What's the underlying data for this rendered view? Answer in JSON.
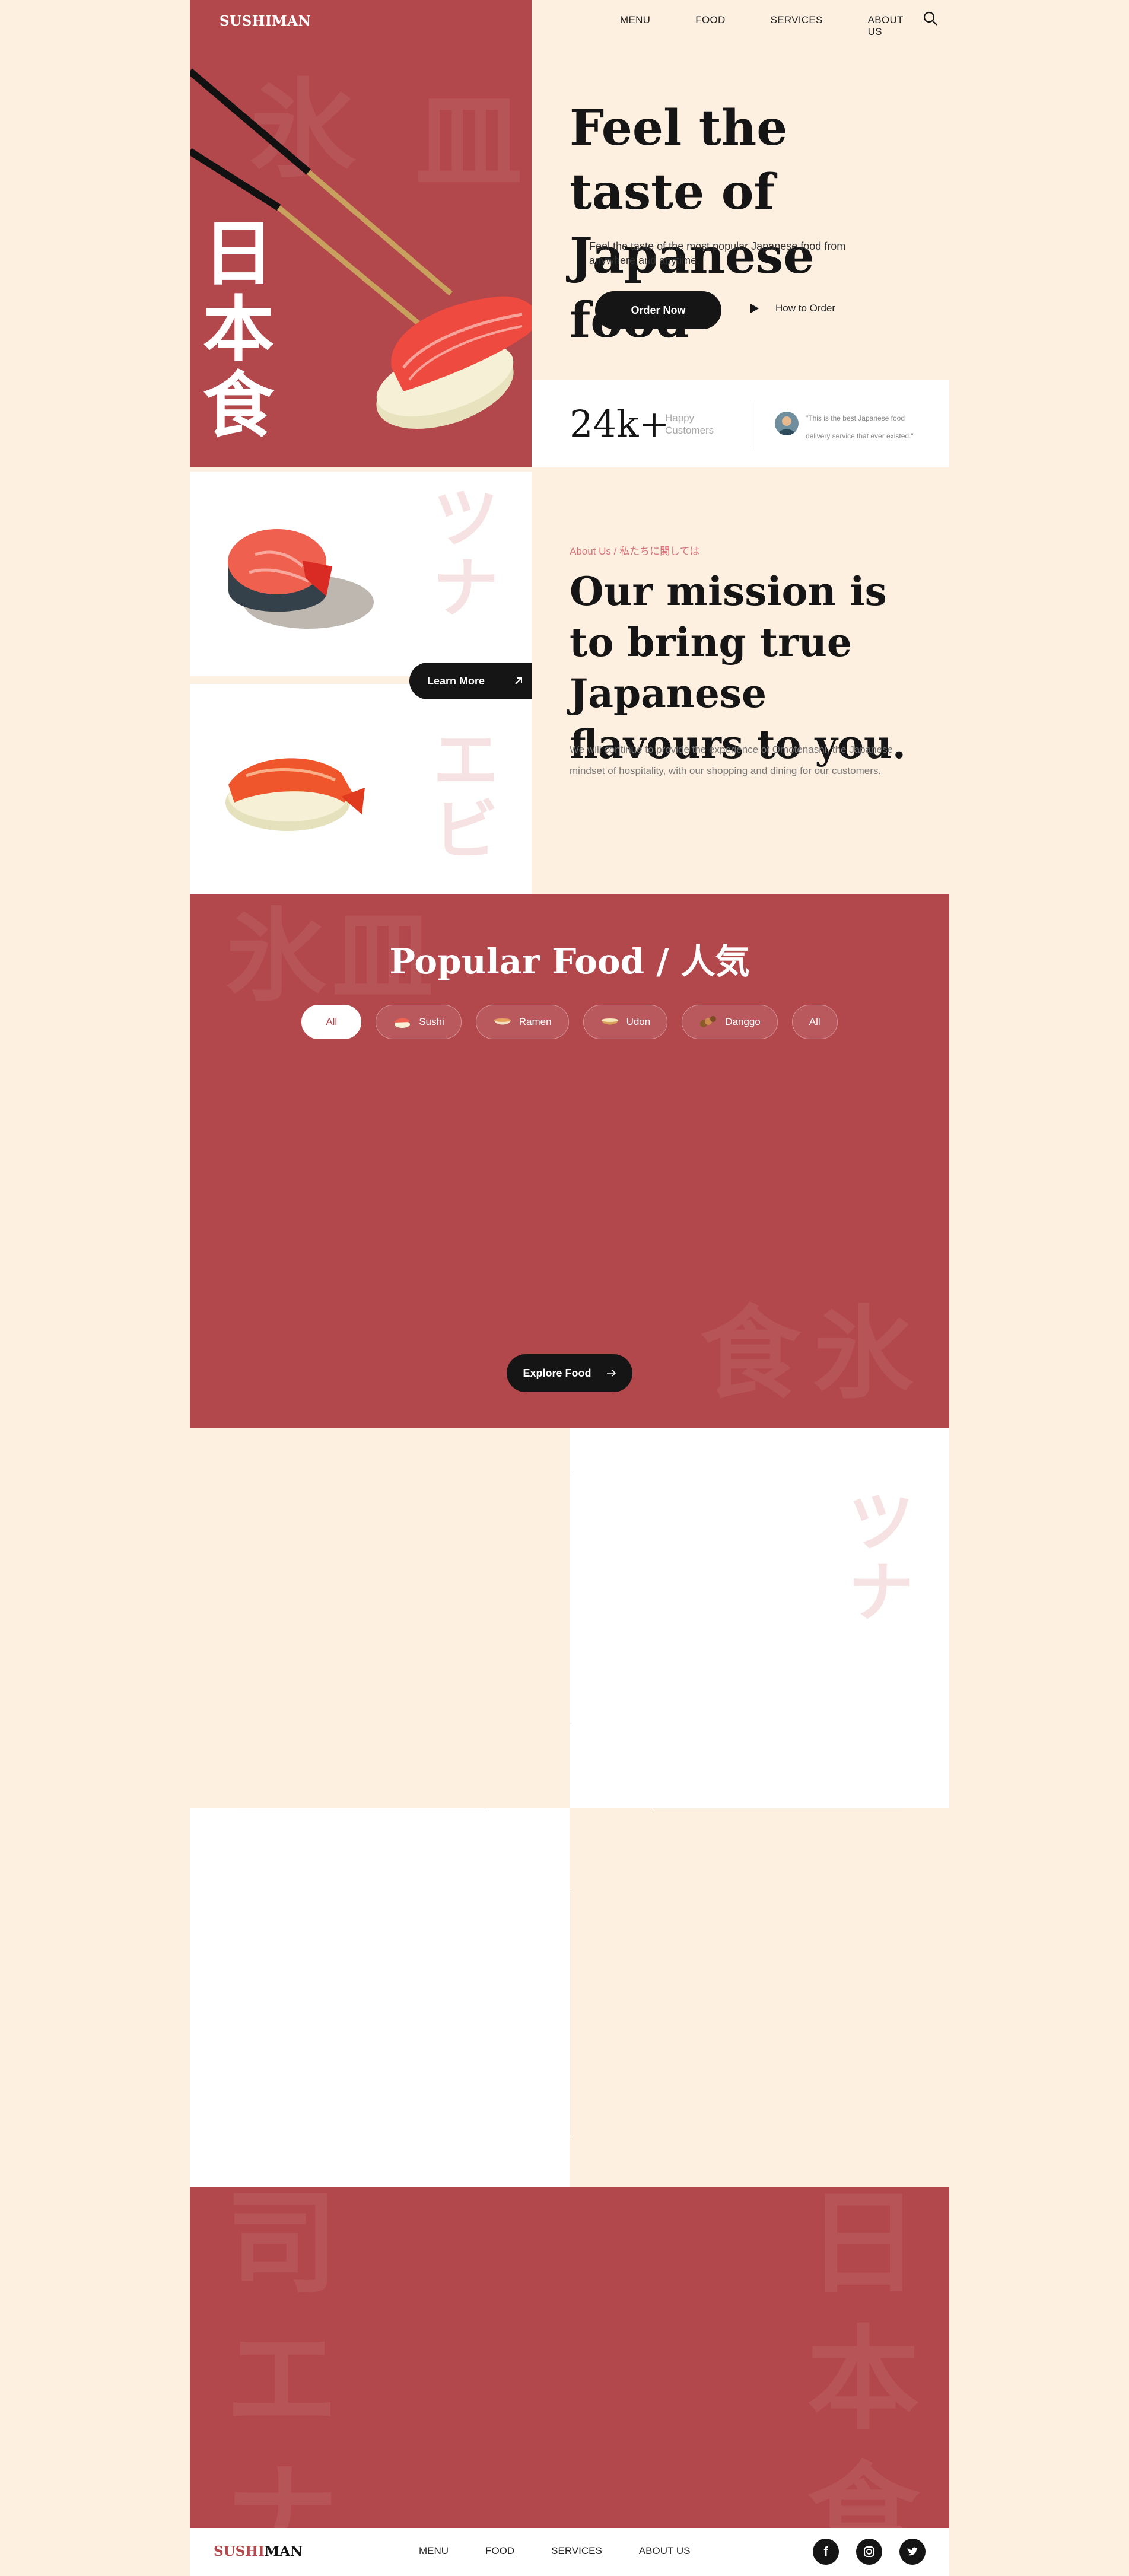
{
  "brand": {
    "logo": "SUSHIMAN",
    "logo_part1": "SUSHI",
    "logo_part2": "MAN",
    "accent": "#B2474C",
    "dark": "#151515",
    "cream": "#FDF0E0"
  },
  "nav": {
    "items": [
      "MENU",
      "FOOD",
      "SERVICES",
      "ABOUT US"
    ],
    "search_icon": "search-icon"
  },
  "hero": {
    "kanji": "日本食",
    "title": "Feel the taste of Japanese food",
    "subtitle": "Feel the taste of the most popular Japanese food from anywhere and anytime.",
    "order_button": "Order Now",
    "how_to_order": "How to Order"
  },
  "stats": {
    "number": "24k+",
    "label": "Happy Customers",
    "quote": "\"This is the best Japanese food delivery service that ever existed.\""
  },
  "about": {
    "card_kanji_1": "ツナ",
    "card_kanji_2": "エビ",
    "learn_more": "Learn More",
    "kicker": "About Us / 私たちに関しては",
    "title": "Our mission is to bring true Japanese flavours to you.",
    "text": "We will continue to provide the experience of Omotenashi, the Japanese mindset of hospitality, with our shopping and dining for our customers."
  },
  "popular": {
    "title": "Popular Food / 人気",
    "chips": [
      "All",
      "Sushi",
      "Ramen",
      "Udon",
      "Danggo",
      "All"
    ],
    "explore_button": "Explore Food"
  },
  "grid": {
    "kanji": "ツナ"
  },
  "footer": {
    "logo_part1": "SUSHI",
    "logo_part2": "MAN",
    "nav": [
      "MENU",
      "FOOD",
      "SERVICES",
      "ABOUT US"
    ],
    "social": [
      "facebook-icon",
      "instagram-icon",
      "twitter-icon"
    ]
  }
}
